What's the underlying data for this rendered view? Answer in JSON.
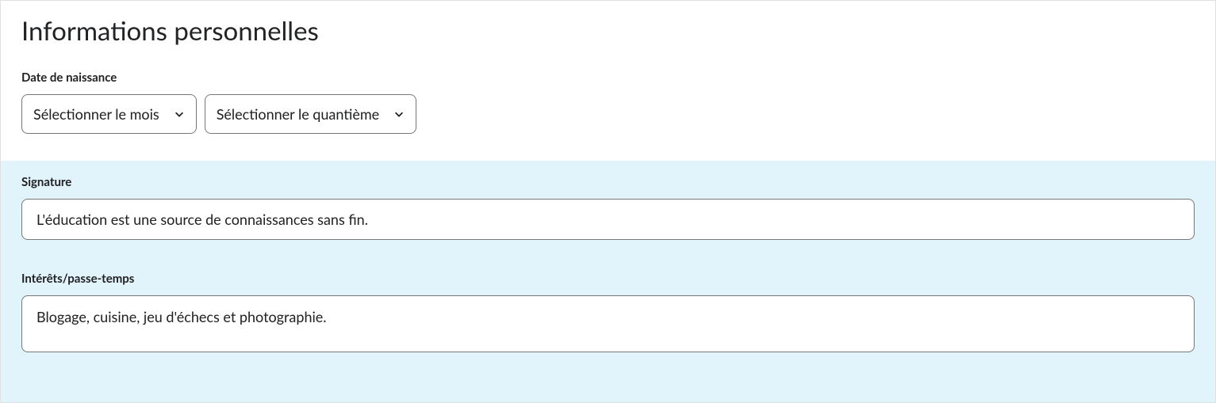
{
  "page": {
    "title": "Informations personnelles"
  },
  "birthdate": {
    "label": "Date de naissance",
    "month_select": "Sélectionner le mois",
    "day_select": "Sélectionner le quantième"
  },
  "signature": {
    "label": "Signature",
    "value": "L'éducation est une source de connaissances sans fin."
  },
  "interests": {
    "label": "Intérêts/passe-temps",
    "value": "Blogage, cuisine, jeu d'échecs et photographie."
  }
}
